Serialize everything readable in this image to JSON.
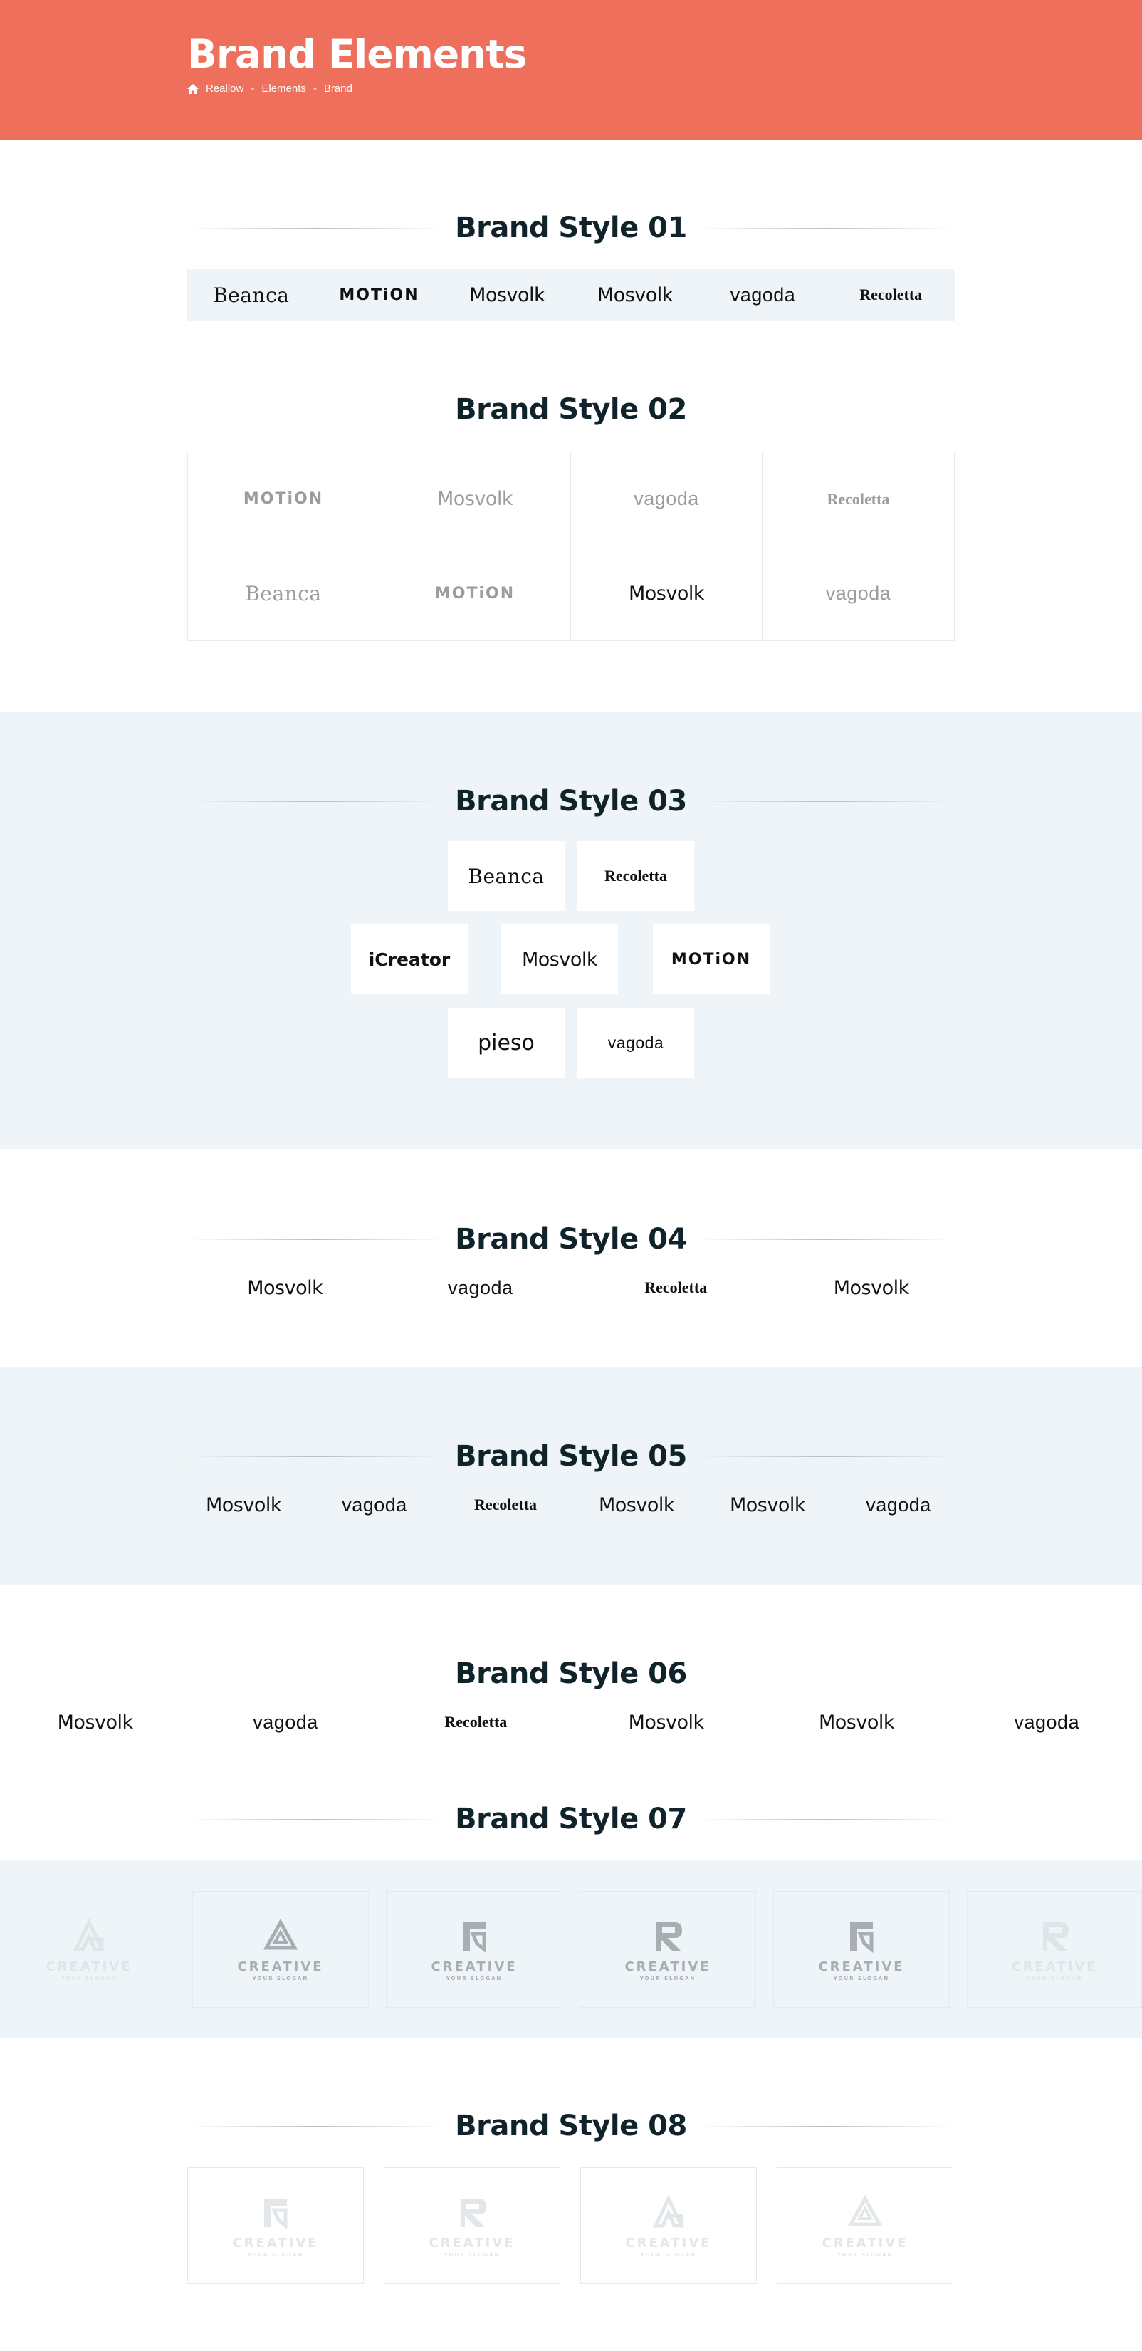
{
  "header": {
    "title": "Brand Elements",
    "breadcrumb": [
      "Reallow",
      "Elements",
      "Brand"
    ],
    "separator": "-",
    "bg_color": "#ef6f5d"
  },
  "sections": {
    "s1": {
      "title": "Brand Style 01",
      "logos": [
        "Beanca",
        "MOTiON",
        "Mosvolk",
        "Mosvolk",
        "vagoda",
        "Recoletta"
      ]
    },
    "s2": {
      "title": "Brand Style 02",
      "logos": [
        "MOTiON",
        "Mosvolk",
        "vagoda",
        "Recoletta",
        "Beanca",
        "MOTiON",
        "Mosvolk",
        "vagoda"
      ]
    },
    "s3": {
      "title": "Brand Style 03",
      "logos": [
        "Beanca",
        "Recoletta",
        "iCreator",
        "Mosvolk",
        "MOTiON",
        "pieso",
        "vagoda"
      ]
    },
    "s4": {
      "title": "Brand Style 04",
      "logos": [
        "Mosvolk",
        "vagoda",
        "Recoletta",
        "Mosvolk"
      ]
    },
    "s5": {
      "title": "Brand Style 05",
      "logos": [
        "Mosvolk",
        "vagoda",
        "Recoletta",
        "Mosvolk",
        "Mosvolk",
        "vagoda"
      ]
    },
    "s6": {
      "title": "Brand Style 06",
      "logos": [
        "Mosvolk",
        "vagoda",
        "Recoletta",
        "Mosvolk",
        "Mosvolk",
        "vagoda"
      ]
    },
    "s7": {
      "title": "Brand Style 07"
    },
    "s8": {
      "title": "Brand Style 08"
    }
  },
  "creative": {
    "word": "CREATIVE",
    "slogan": "YOUR SLOGAN"
  },
  "colors": {
    "accent": "#ef6f5d",
    "band": "#eef4f7",
    "heading": "#10232b"
  }
}
